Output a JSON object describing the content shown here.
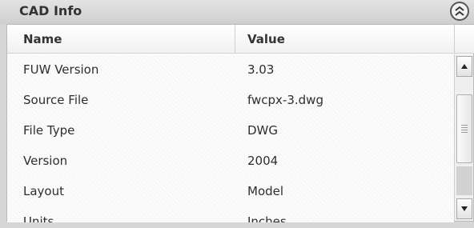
{
  "panel": {
    "title": "CAD Info",
    "collapse_icon": "double-chevron-up-icon"
  },
  "grid": {
    "columns": [
      "Name",
      "Value"
    ],
    "rows": [
      {
        "name": "FUW Version",
        "value": "3.03"
      },
      {
        "name": "Source File",
        "value": "fwcpx-3.dwg"
      },
      {
        "name": "File Type",
        "value": "DWG"
      },
      {
        "name": "Version",
        "value": "2004"
      },
      {
        "name": "Layout",
        "value": "Model"
      },
      {
        "name": "Units",
        "value": "Inches"
      }
    ]
  },
  "scrollbar": {
    "up_icon": "arrow-up-icon",
    "down_icon": "arrow-down-icon"
  },
  "colors": {
    "header_bg": "#d6d6d6",
    "grid_bg": "#ffffff",
    "text": "#2e2e2e"
  }
}
